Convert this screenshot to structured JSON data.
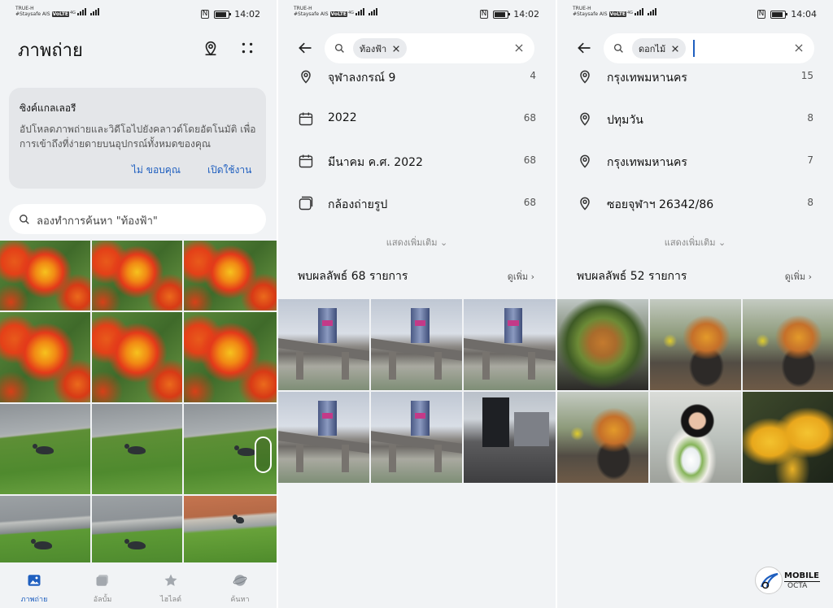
{
  "screens": [
    {
      "status": {
        "carrier1": "TRUE-H",
        "carrier2": "#Staysafe AIS",
        "tag": "VoLTE",
        "net": "4G",
        "time": "14:02"
      },
      "title": "ภาพถ่าย",
      "header_icons": [
        "location-pin-icon",
        "more-dots-icon"
      ],
      "sync_card": {
        "title": "ซิงค์แกลเลอรี",
        "description": "อัปโหลดภาพถ่ายและวิดีโอไปยังคลาวด์โดยอัตโนมัติ เพื่อการเข้าถึงที่ง่ายดายบนอุปกรณ์ทั้งหมดของคุณ",
        "decline": "ไม่ ขอบคุณ",
        "accept": "เปิดใช้งาน"
      },
      "search_placeholder": "ลองทำการค้นหา \"ท้องฟ้า\"",
      "bottom_nav": [
        {
          "label": "ภาพถ่าย",
          "icon": "photos-icon",
          "active": true
        },
        {
          "label": "อัลบั้ม",
          "icon": "albums-icon",
          "active": false
        },
        {
          "label": "ไฮไลต์",
          "icon": "star-icon",
          "active": false
        },
        {
          "label": "ค้นหา",
          "icon": "discover-icon",
          "active": false
        }
      ]
    },
    {
      "status": {
        "carrier1": "TRUE-H",
        "carrier2": "#Staysafe AIS",
        "tag": "VoLTE",
        "net": "4G",
        "time": "14:02"
      },
      "query_chip": "ท้องฟ้า",
      "rows": [
        {
          "icon": "location-pin-icon",
          "label": "จุฬาลงกรณ์ 9",
          "count": "4"
        },
        {
          "icon": "calendar-icon",
          "label": "2022",
          "count": "68"
        },
        {
          "icon": "calendar-icon",
          "label": "มีนาคม ค.ศ. 2022",
          "count": "68"
        },
        {
          "icon": "camera-album-icon",
          "label": "กล้องถ่ายรูป",
          "count": "68"
        }
      ],
      "show_more": "แสดงเพิ่มเติม",
      "results": "พบผลลัพธ์ 68 รายการ",
      "view_more": "ดูเพิ่ม"
    },
    {
      "status": {
        "carrier1": "TRUE-H",
        "carrier2": "#Staysafe AIS",
        "tag": "VoLTE",
        "net": "4G",
        "time": "14:04"
      },
      "query_chip": "ดอกไม้",
      "rows": [
        {
          "icon": "location-pin-icon",
          "label": "กรุงเทพมหานคร",
          "count": "15"
        },
        {
          "icon": "location-pin-icon",
          "label": "ปทุมวัน",
          "count": "8"
        },
        {
          "icon": "location-pin-icon",
          "label": "กรุงเทพมหานคร",
          "count": "7"
        },
        {
          "icon": "location-pin-icon",
          "label": "ซอยจุฬาฯ 26342/86",
          "count": "8"
        }
      ],
      "show_more": "แสดงเพิ่มเติม",
      "results": "พบผลลัพธ์ 52 รายการ",
      "view_more": "ดูเพิ่ม"
    }
  ],
  "watermark": {
    "line1": "MOBILE",
    "line2": "OCTA"
  }
}
